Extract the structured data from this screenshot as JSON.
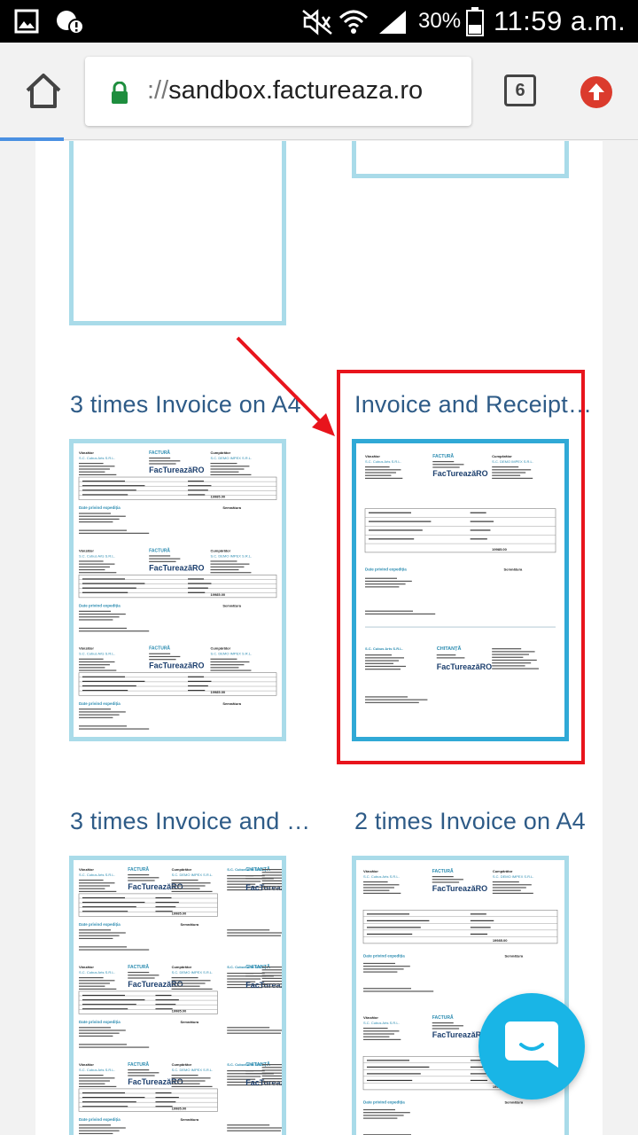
{
  "status_bar": {
    "battery_percent": "30%",
    "time": "11:59 a.m.",
    "icons": [
      "gallery-icon",
      "alert-bubble-icon",
      "mute-icon",
      "wifi-icon",
      "signal-icon",
      "battery-icon"
    ]
  },
  "browser": {
    "url_scheme": "://",
    "url_host": "sandbox.factureaza.ro",
    "tab_count": "6",
    "load_progress": 0.1
  },
  "templates": [
    {
      "title": "3 times Invoice on A4",
      "kind": "triple-invoice",
      "selected": false
    },
    {
      "title": "Invoice and Receipt…",
      "kind": "invoice-receipt",
      "selected": true
    },
    {
      "title": "3 times Invoice and …",
      "kind": "triple-invoice-receipt",
      "selected": false
    },
    {
      "title": "2 times Invoice on A4",
      "kind": "double-invoice",
      "selected": false
    }
  ],
  "thumbnail_text": {
    "brand": "FacTureazăRO",
    "invoice_word": "FACTURĂ",
    "receipt_word": "CHITANȚĂ",
    "seller": "Vânzător",
    "buyer": "Cumpărător",
    "seller_name": "S.C. Cubus Arts S.R.L.",
    "buyer_name": "S.C. DEMO IMPEX S.R.L.",
    "delivery": "Date privind expediția",
    "signature": "Semnătura",
    "total": "19985.00"
  },
  "colors": {
    "accent": "#2e5b87",
    "highlight": "#e8141c",
    "thumb_border": "#a9dbe9",
    "fab": "#19b5e6"
  }
}
